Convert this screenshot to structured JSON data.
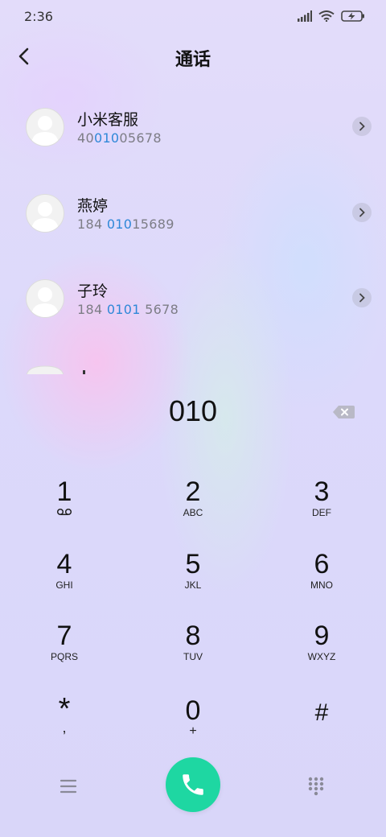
{
  "status": {
    "time": "2:36"
  },
  "header": {
    "title": "通话"
  },
  "contacts": [
    {
      "name": "小米客服",
      "num_pre": "40",
      "num_hl": "010",
      "num_post": "05678"
    },
    {
      "name": "燕婷",
      "num_pre": "184 ",
      "num_hl": "010",
      "num_post": "15689"
    },
    {
      "name": "子玲",
      "num_pre": "184 ",
      "num_hl": "0101",
      "num_post": " 5678"
    }
  ],
  "dialer": {
    "input": "010",
    "keys": [
      {
        "digit": "1",
        "sub": "voicemail-icon"
      },
      {
        "digit": "2",
        "sub": "ABC"
      },
      {
        "digit": "3",
        "sub": "DEF"
      },
      {
        "digit": "4",
        "sub": "GHI"
      },
      {
        "digit": "5",
        "sub": "JKL"
      },
      {
        "digit": "6",
        "sub": "MNO"
      },
      {
        "digit": "7",
        "sub": "PQRS"
      },
      {
        "digit": "8",
        "sub": "TUV"
      },
      {
        "digit": "9",
        "sub": "WXYZ"
      },
      {
        "digit": "*",
        "sub": ","
      },
      {
        "digit": "0",
        "sub": "+"
      },
      {
        "digit": "#",
        "sub": ""
      }
    ]
  },
  "colors": {
    "accent": "#1ed7a2",
    "highlight": "#2f88d8"
  }
}
